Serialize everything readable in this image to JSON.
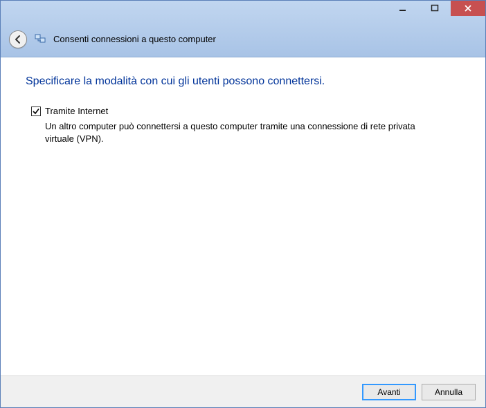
{
  "titlebar": {
    "minimize": "minimize",
    "maximize": "maximize",
    "close": "close"
  },
  "header": {
    "title": "Consenti connessioni a questo computer"
  },
  "content": {
    "heading": "Specificare la modalità con cui gli utenti possono connettersi.",
    "option": {
      "label": "Tramite Internet",
      "checked": true,
      "description": "Un altro computer può connettersi a questo computer tramite una connessione di rete privata virtuale (VPN)."
    }
  },
  "footer": {
    "next": "Avanti",
    "cancel": "Annulla"
  }
}
